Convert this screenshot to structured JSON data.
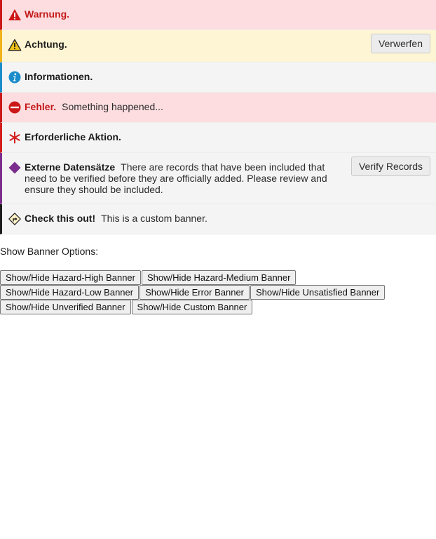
{
  "colors": {
    "hazard_high": "#cc1818",
    "hazard_medium": "#f2b21a",
    "hazard_low": "#1a8ccc",
    "error": "#cc1818",
    "unsatisfied": "#d41e1e",
    "unverified": "#7b2d8e",
    "custom": "#1c1c1c"
  },
  "banners": {
    "hazard_high": {
      "icon": "warning-triangle-icon",
      "title": "Warnung."
    },
    "hazard_medium": {
      "icon": "caution-triangle-icon",
      "title": "Achtung.",
      "action": "Verwerfen"
    },
    "hazard_low": {
      "icon": "info-circle-icon",
      "title": "Informationen."
    },
    "error": {
      "icon": "no-entry-icon",
      "title": "Fehler.",
      "message": "Something happened..."
    },
    "unsatisfied": {
      "icon": "asterisk-icon",
      "title": "Erforderliche Aktion."
    },
    "unverified": {
      "icon": "diamond-icon",
      "title": "Externe Datensätze",
      "message": "There are records that have been included that need to be verified before they are officially added. Please review and ensure they should be included.",
      "action": "Verify Records"
    },
    "custom": {
      "icon": "road-sign-icon",
      "title": "Check this out!",
      "message": "This is a custom banner."
    }
  },
  "options": {
    "label": "Show Banner Options:",
    "buttons": [
      "Show/Hide Hazard-High Banner",
      "Show/Hide Hazard-Medium Banner",
      "Show/Hide Hazard-Low Banner",
      "Show/Hide Error Banner",
      "Show/Hide Unsatisfied Banner",
      "Show/Hide Unverified Banner",
      "Show/Hide Custom Banner"
    ]
  }
}
